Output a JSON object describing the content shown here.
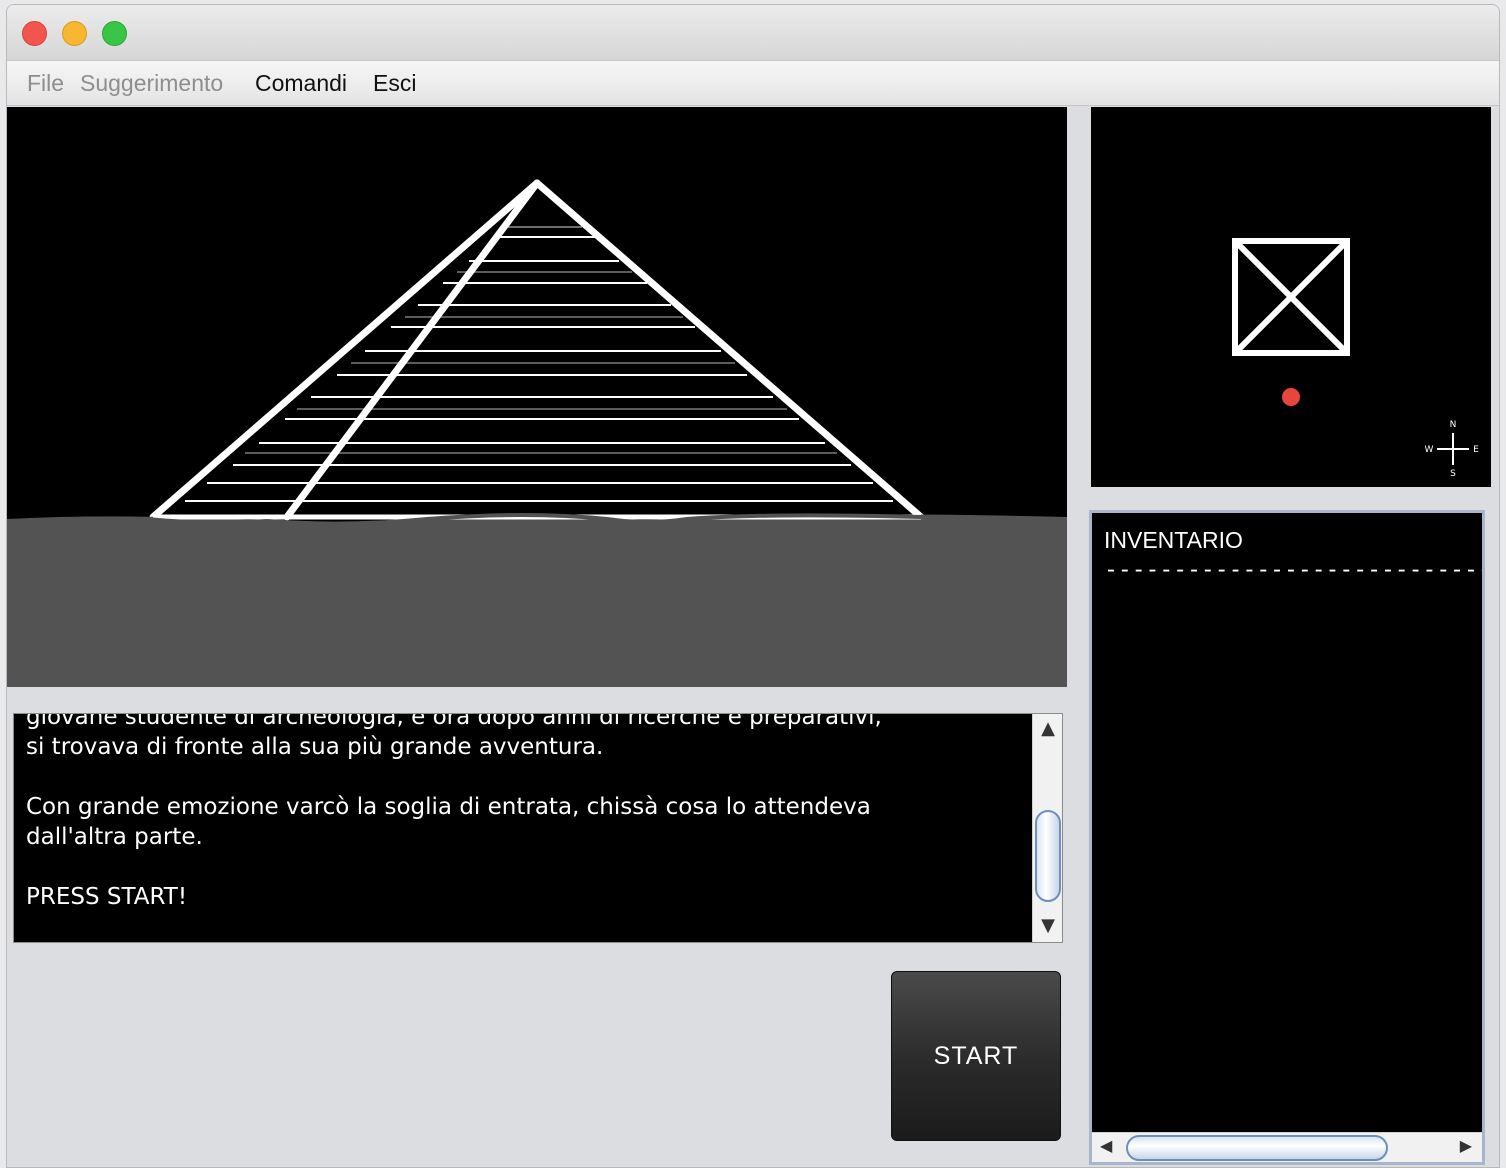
{
  "window": {
    "controls": [
      "close-icon",
      "minimize-icon",
      "maximize-icon"
    ]
  },
  "menu": {
    "file": "File",
    "hint": "Suggerimento",
    "commands": "Comandi",
    "exit": "Esci"
  },
  "scene": {
    "description_icon": "pyramid-icon",
    "colors": {
      "sky": "#000000",
      "ground": "#535353",
      "lines": "#ffffff"
    }
  },
  "minimap": {
    "room_icon": "room-box-icon",
    "player_icon": "player-dot-icon",
    "compass": {
      "n": "N",
      "s": "S",
      "w": "W",
      "e": "E"
    },
    "player_color": "#e8453c"
  },
  "story": {
    "text": "giovane studente di archeologia, e ora dopo anni di ricerche e preparativi,\nsi trovava di fronte alla sua più grande avventura.\n\nCon grande emozione varcò la soglia di entrata, chissà cosa lo attendeva\ndall'altra parte.\n\nPRESS START!"
  },
  "start_button": {
    "label": "START"
  },
  "inventory": {
    "title": "INVENTARIO",
    "separator": "----------------------------",
    "items": []
  }
}
